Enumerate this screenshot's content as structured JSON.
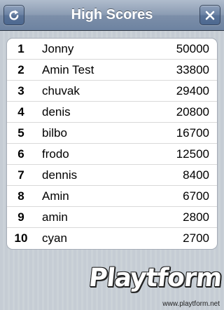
{
  "header": {
    "title": "High Scores",
    "refresh_icon": "refresh-icon",
    "close_icon": "close-icon"
  },
  "scores": [
    {
      "rank": "1",
      "name": "Jonny",
      "score": "50000"
    },
    {
      "rank": "2",
      "name": "Amin Test",
      "score": "33800"
    },
    {
      "rank": "3",
      "name": "chuvak",
      "score": "29400"
    },
    {
      "rank": "4",
      "name": "denis",
      "score": "20800"
    },
    {
      "rank": "5",
      "name": "bilbo",
      "score": "16700"
    },
    {
      "rank": "6",
      "name": "frodo",
      "score": "12500"
    },
    {
      "rank": "7",
      "name": "dennis",
      "score": "8400"
    },
    {
      "rank": "8",
      "name": "Amin",
      "score": "6700"
    },
    {
      "rank": "9",
      "name": "amin",
      "score": "2800"
    },
    {
      "rank": "10",
      "name": "cyan",
      "score": "2700"
    }
  ],
  "watermark": {
    "logo": "Playtform",
    "url": "www.playtform.net"
  },
  "colors": {
    "navbar": "#7d8fa9",
    "background": "#c5ccd4",
    "table": "#ffffff"
  }
}
